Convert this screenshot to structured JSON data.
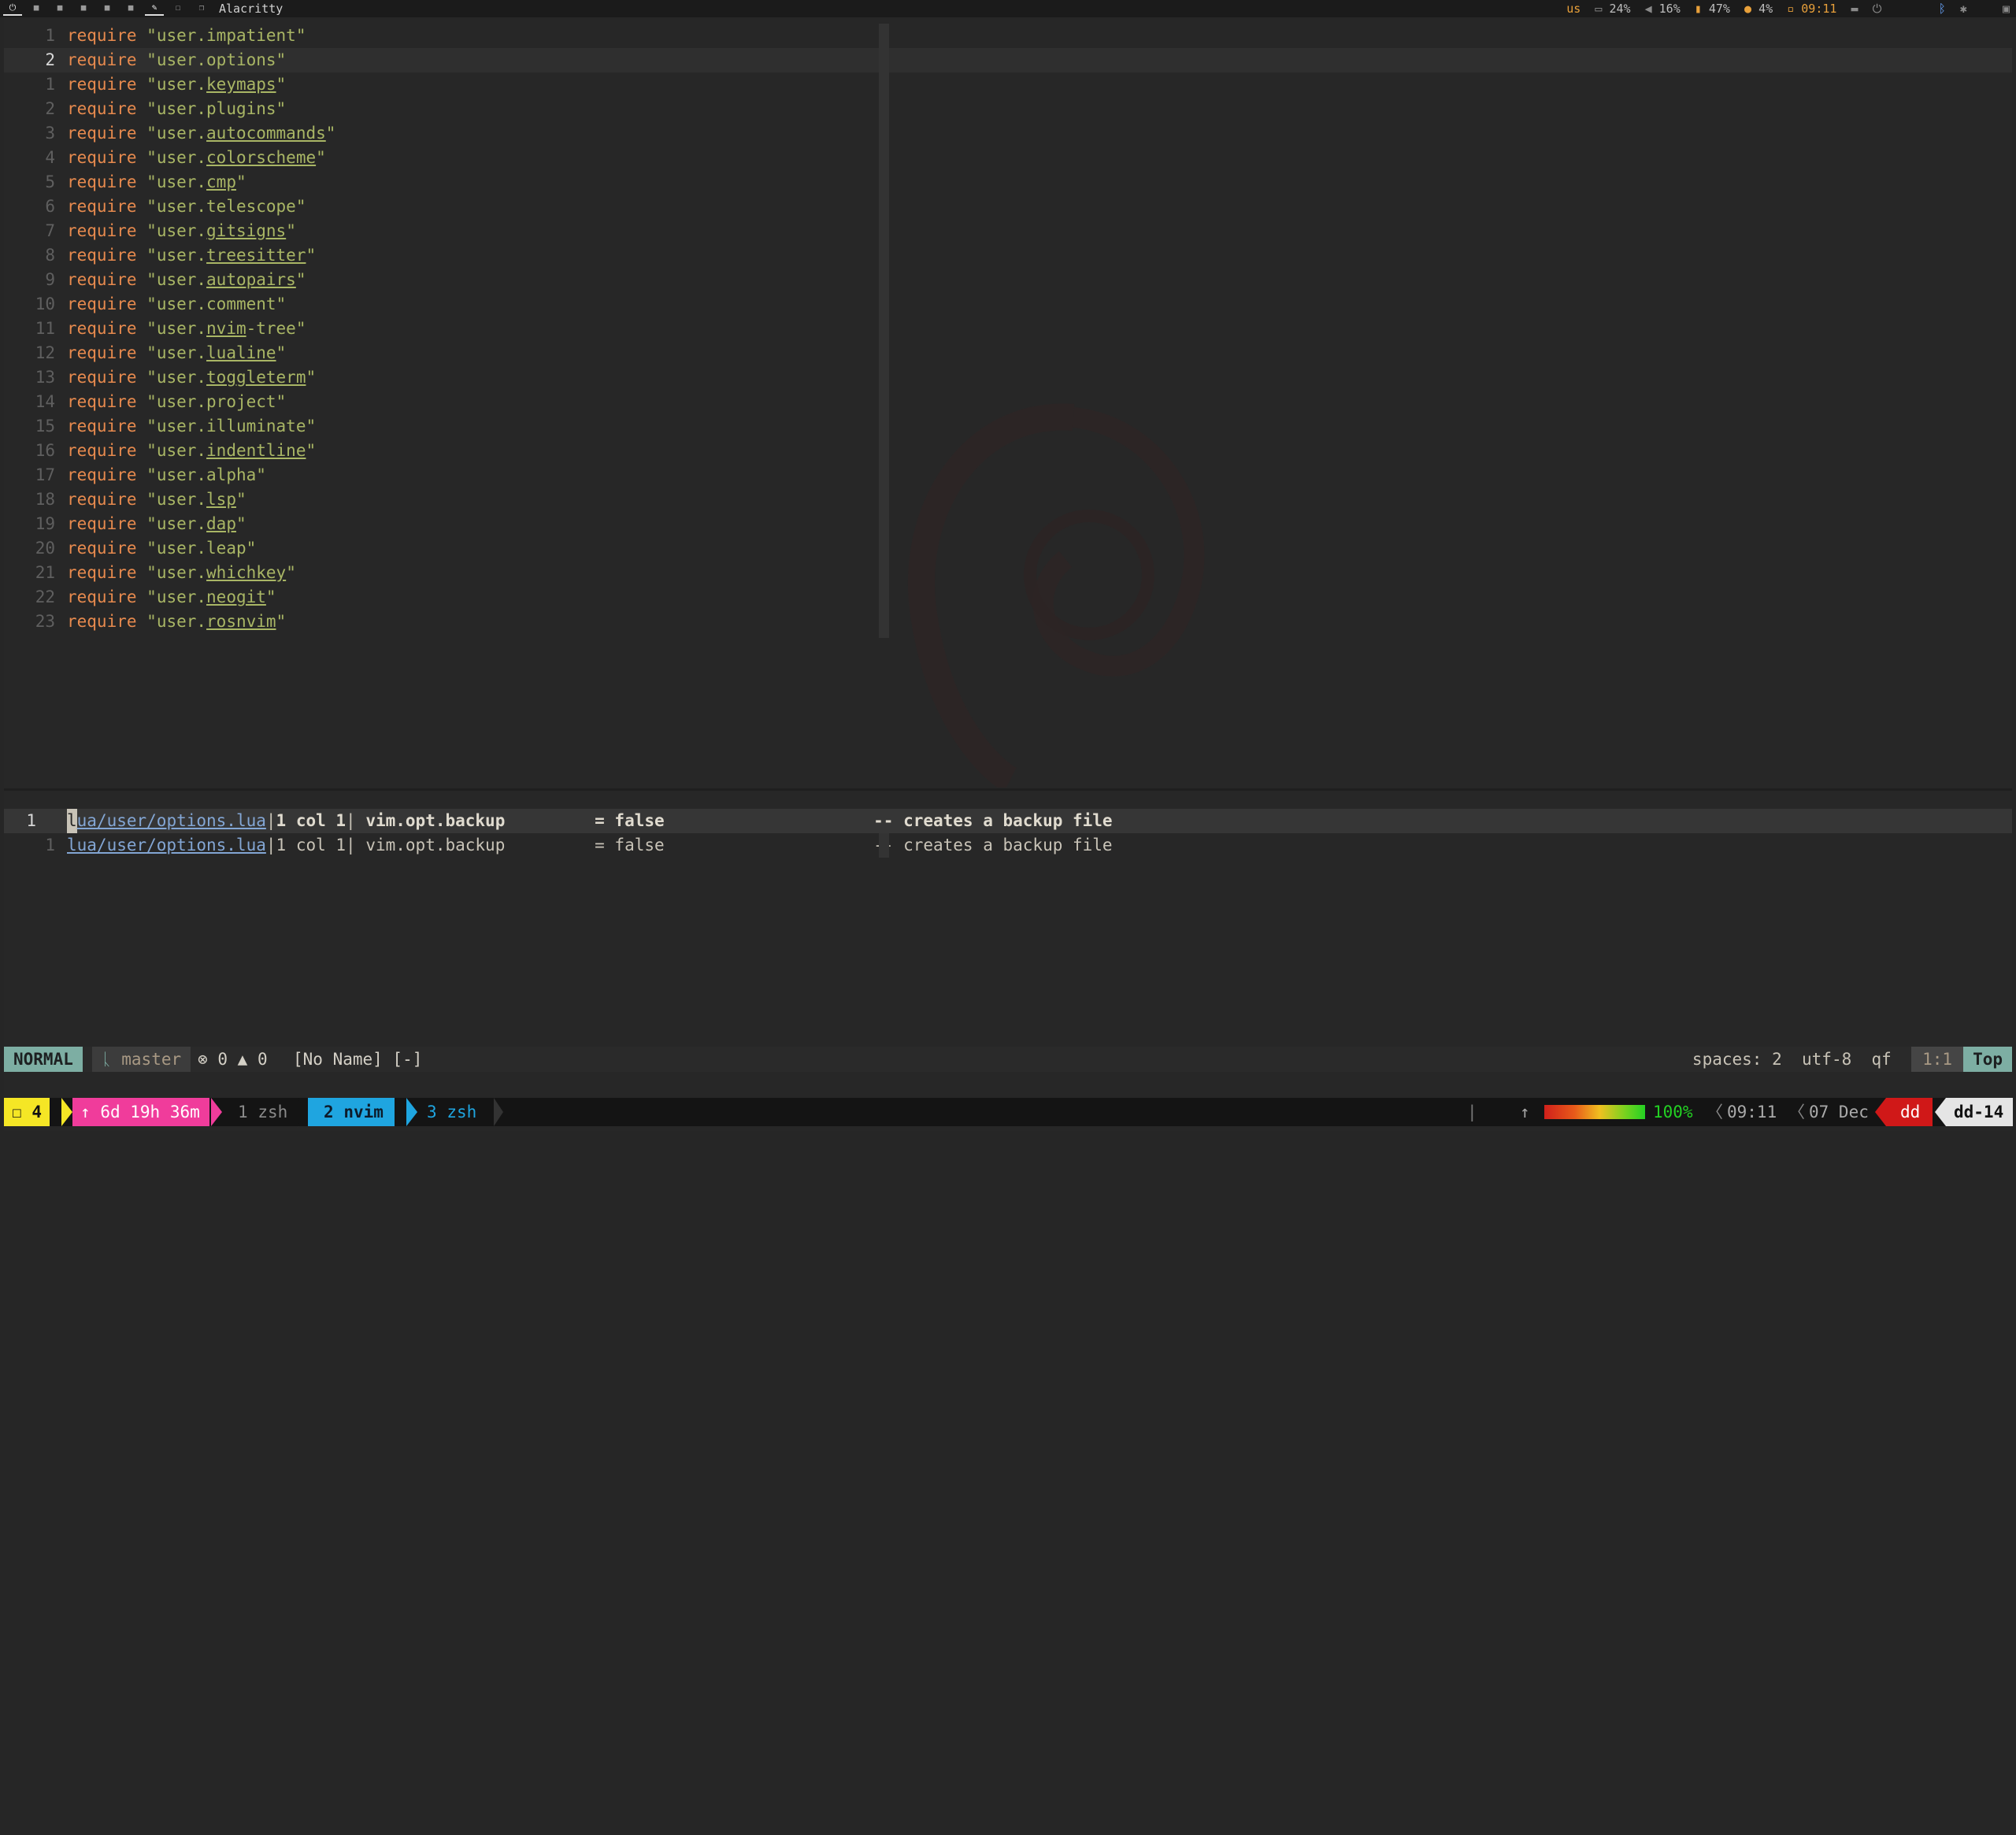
{
  "wm": {
    "title": "Alacritty",
    "workspaces": [
      "⏻",
      "■",
      "■",
      "■",
      "■",
      "■",
      "✎",
      "☐",
      "❐"
    ],
    "status": {
      "layout": "us",
      "disk": "24%",
      "volume": "16%",
      "battery": "47%",
      "cpu": "4%",
      "time": "09:11"
    }
  },
  "editor": {
    "lines": [
      {
        "num": "1",
        "module": "impatient",
        "underline": false,
        "current": false
      },
      {
        "num": "2",
        "module": "options",
        "underline": false,
        "current": true
      },
      {
        "num": "1",
        "module": "keymaps",
        "underline": true,
        "current": false
      },
      {
        "num": "2",
        "module": "plugins",
        "underline": false,
        "current": false
      },
      {
        "num": "3",
        "module": "autocommands",
        "underline": true,
        "current": false
      },
      {
        "num": "4",
        "module": "colorscheme",
        "underline": true,
        "current": false
      },
      {
        "num": "5",
        "module": "cmp",
        "underline": true,
        "current": false
      },
      {
        "num": "6",
        "module": "telescope",
        "underline": false,
        "current": false
      },
      {
        "num": "7",
        "module": "gitsigns",
        "underline": true,
        "current": false
      },
      {
        "num": "8",
        "module": "treesitter",
        "underline": true,
        "current": false
      },
      {
        "num": "9",
        "module": "autopairs",
        "underline": true,
        "current": false
      },
      {
        "num": "10",
        "module": "comment",
        "underline": false,
        "current": false
      },
      {
        "num": "11",
        "module": "nvim-tree",
        "underline": "nvim",
        "current": false
      },
      {
        "num": "12",
        "module": "lualine",
        "underline": true,
        "current": false
      },
      {
        "num": "13",
        "module": "toggleterm",
        "underline": true,
        "current": false
      },
      {
        "num": "14",
        "module": "project",
        "underline": false,
        "current": false
      },
      {
        "num": "15",
        "module": "illuminate",
        "underline": false,
        "current": false
      },
      {
        "num": "16",
        "module": "indentline",
        "underline": true,
        "current": false
      },
      {
        "num": "17",
        "module": "alpha",
        "underline": false,
        "current": false
      },
      {
        "num": "18",
        "module": "lsp",
        "underline": true,
        "current": false
      },
      {
        "num": "19",
        "module": "dap",
        "underline": true,
        "current": false
      },
      {
        "num": "20",
        "module": "leap",
        "underline": false,
        "current": false
      },
      {
        "num": "21",
        "module": "whichkey",
        "underline": true,
        "current": false
      },
      {
        "num": "22",
        "module": "neogit",
        "underline": true,
        "current": false
      },
      {
        "num": "23",
        "module": "rosnvim",
        "underline": true,
        "current": false
      }
    ],
    "keyword": "require",
    "prefix": "user."
  },
  "quickfix": {
    "items": [
      {
        "num": "1",
        "path": "lua/user/options.lua",
        "loc": "1 col 1",
        "code": "vim.opt.backup",
        "assign": "= false",
        "comment": "-- creates a backup file",
        "selected": true
      },
      {
        "num": "1",
        "path": "lua/user/options.lua",
        "loc": "1 col 1",
        "code": "vim.opt.backup",
        "assign": "= false",
        "comment": "-- creates a backup file",
        "selected": false
      }
    ]
  },
  "statusline": {
    "mode": "NORMAL",
    "branch_icon": "ᚳ",
    "branch": "master",
    "errors": "0",
    "warnings": "0",
    "file": "[No Name] [-]",
    "indent": "spaces: 2",
    "encoding": "utf-8",
    "filetype": "qf",
    "position": "1:1",
    "progress": "Top"
  },
  "tmux": {
    "session": "4",
    "uptime": "6d 19h 36m",
    "windows": [
      {
        "index": "1",
        "name": "zsh",
        "active": false
      },
      {
        "index": "2",
        "name": "nvim",
        "active": true
      },
      {
        "index": "3",
        "name": "zsh",
        "active": false
      }
    ],
    "battery_percent": "100%",
    "battery_level": 1.0,
    "time": "09:11",
    "date": "07 Dec",
    "user": "dd",
    "host": "dd-14"
  },
  "colors": {
    "tmux_session": "#f5e625",
    "tmux_uptime": "#f03c9b",
    "tmux_active": "#1fa5e0",
    "tmux_user": "#d01818",
    "tmux_host": "#e5e5e5",
    "statusline_mode": "#7daea3"
  }
}
